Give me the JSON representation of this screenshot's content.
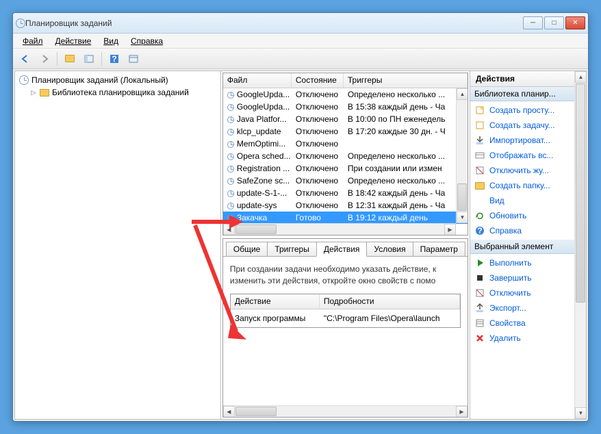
{
  "window": {
    "title": "Планировщик заданий"
  },
  "menu": {
    "file": "Файл",
    "action": "Действие",
    "view": "Вид",
    "help": "Справка"
  },
  "tree": {
    "root": "Планировщик заданий (Локальный)",
    "library": "Библиотека планировщика заданий"
  },
  "columns": {
    "file": "Файл",
    "state": "Состояние",
    "triggers": "Триггеры"
  },
  "tasks": [
    {
      "name": "GoogleUpda...",
      "state": "Отключено",
      "trigger": "Определено несколько ..."
    },
    {
      "name": "GoogleUpda...",
      "state": "Отключено",
      "trigger": "В 15:38 каждый день - Ча"
    },
    {
      "name": "Java Platfor...",
      "state": "Отключено",
      "trigger": "В 10:00 по ПН еженедель"
    },
    {
      "name": "klcp_update",
      "state": "Отключено",
      "trigger": "В 17:20 каждые 30 дн. - Ч"
    },
    {
      "name": "MemOptimi...",
      "state": "Отключено",
      "trigger": ""
    },
    {
      "name": "Opera sched...",
      "state": "Отключено",
      "trigger": "Определено несколько ..."
    },
    {
      "name": "Registration ...",
      "state": "Отключено",
      "trigger": "При создании или измен"
    },
    {
      "name": "SafeZone sc...",
      "state": "Отключено",
      "trigger": "Определено несколько ..."
    },
    {
      "name": "update-S-1-...",
      "state": "Отключено",
      "trigger": "В 18:42 каждый день - Ча"
    },
    {
      "name": "update-sys",
      "state": "Отключено",
      "trigger": "В 12:31 каждый день - Ча"
    },
    {
      "name": "Закачка",
      "state": "Готово",
      "trigger": "В 19:12 каждый день",
      "selected": true
    }
  ],
  "tabs": {
    "general": "Общие",
    "triggers": "Триггеры",
    "actions": "Действия",
    "conditions": "Условия",
    "settings": "Параметр"
  },
  "actions_hint": "При создании задачи необходимо указать действие, к изменить эти действия, откройте окно свойств с помо",
  "action_columns": {
    "action": "Действие",
    "details": "Подробности"
  },
  "action_row": {
    "action": "Запуск программы",
    "details": "\"C:\\Program Files\\Opera\\launch"
  },
  "actions_pane": {
    "title": "Действия",
    "library_header": "Библиотека планир...",
    "selected_header": "Выбранный элемент",
    "library_items": [
      {
        "icon": "wizard",
        "label": "Создать просту..."
      },
      {
        "icon": "task",
        "label": "Создать задачу..."
      },
      {
        "icon": "import",
        "label": "Импортироват..."
      },
      {
        "icon": "display",
        "label": "Отображать вс..."
      },
      {
        "icon": "disable",
        "label": "Отключить жу..."
      },
      {
        "icon": "folder",
        "label": "Создать папку..."
      },
      {
        "icon": "view",
        "label": "Вид",
        "arrow": true
      },
      {
        "icon": "refresh",
        "label": "Обновить"
      },
      {
        "icon": "help",
        "label": "Справка"
      }
    ],
    "selected_items": [
      {
        "icon": "run",
        "label": "Выполнить"
      },
      {
        "icon": "end",
        "label": "Завершить"
      },
      {
        "icon": "disable",
        "label": "Отключить"
      },
      {
        "icon": "export",
        "label": "Экспорт..."
      },
      {
        "icon": "props",
        "label": "Свойства"
      },
      {
        "icon": "delete",
        "label": "Удалить"
      }
    ]
  }
}
